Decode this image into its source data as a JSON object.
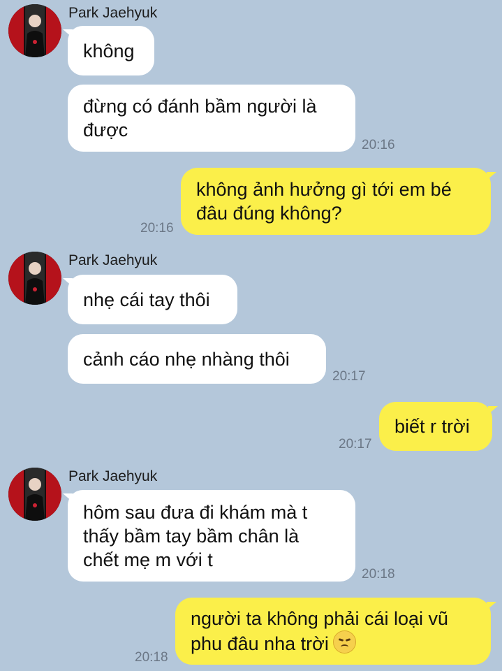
{
  "chat": {
    "groups": [
      {
        "sender": "Park Jaehyuk",
        "messages": [
          "không",
          "đừng có đánh bầm người là\nđược"
        ],
        "time": "20:16"
      },
      {
        "sender": "Park Jaehyuk",
        "messages": [
          "nhẹ cái tay thôi",
          "cảnh cáo nhẹ nhàng thôi"
        ],
        "time": "20:17"
      },
      {
        "sender": "Park Jaehyuk",
        "messages": [
          "hôm sau đưa đi khám mà t\nthấy bầm tay bầm chân là\nchết mẹ m với t"
        ],
        "time": "20:18"
      }
    ],
    "outgoing": [
      {
        "text": "không ảnh hưởng gì tới em bé\nđâu đúng không?",
        "time": "20:16"
      },
      {
        "text": "biết r trời",
        "time": "20:17"
      },
      {
        "text": "người ta không phải cái loại vũ\nphu đâu nha trời",
        "time": "20:18",
        "emoji": "disappointed-face-icon"
      }
    ]
  },
  "colors": {
    "background": "#b4c7da",
    "incoming_bubble": "#ffffff",
    "outgoing_bubble": "#fbef4a"
  }
}
